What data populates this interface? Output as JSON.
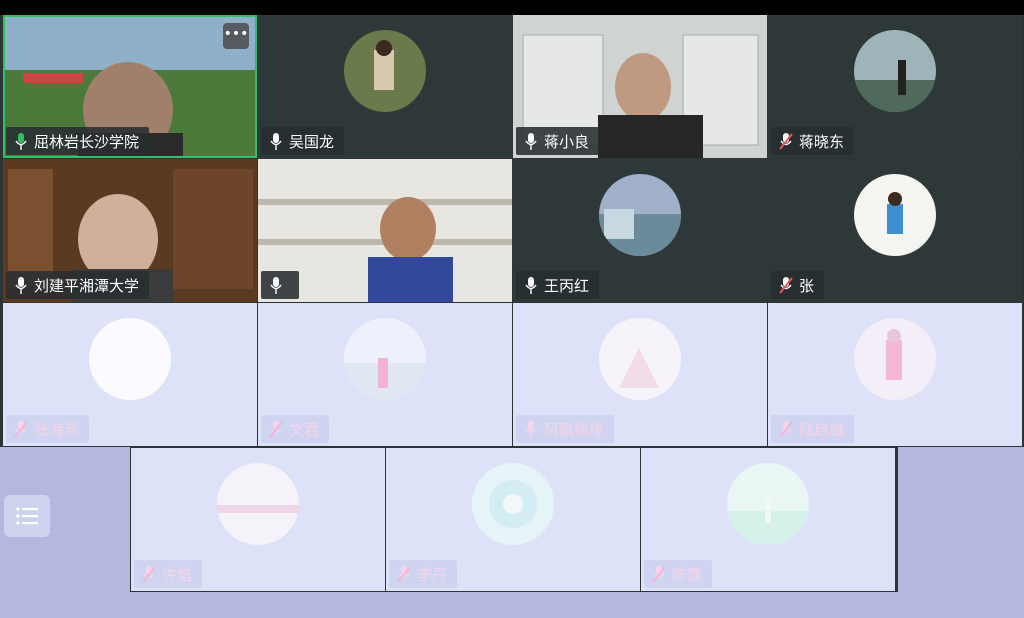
{
  "more_button_label": "•••",
  "participants": [
    {
      "name": "屈林岩长沙学院",
      "muted": false,
      "type": "video",
      "active": true
    },
    {
      "name": "吴国龙",
      "muted": false,
      "type": "avatar"
    },
    {
      "name": "蒋小良",
      "muted": false,
      "type": "video"
    },
    {
      "name": "蒋晓东",
      "muted": true,
      "type": "avatar"
    },
    {
      "name": "刘建平湘潭大学",
      "muted": false,
      "type": "video"
    },
    {
      "name": "",
      "muted": false,
      "type": "video"
    },
    {
      "name": "王丙红",
      "muted": false,
      "type": "avatar"
    },
    {
      "name": "张",
      "muted": true,
      "type": "avatar"
    },
    {
      "name": "张海燕",
      "muted": true,
      "type": "avatar"
    },
    {
      "name": "文君",
      "muted": true,
      "type": "avatar"
    },
    {
      "name": "风飘情缘",
      "muted": false,
      "type": "avatar"
    },
    {
      "name": "陆启越",
      "muted": true,
      "type": "avatar"
    },
    {
      "name": "许焰",
      "muted": true,
      "type": "avatar"
    },
    {
      "name": "李丹",
      "muted": true,
      "type": "avatar"
    },
    {
      "name": "陈露",
      "muted": true,
      "type": "avatar"
    }
  ],
  "colors": {
    "active_border": "#2fbf6a",
    "mic_on": "#ffffff",
    "mic_off": "#e05a5a",
    "tile_bg": "#2f3839",
    "washed_bg": "#dde2f8"
  }
}
